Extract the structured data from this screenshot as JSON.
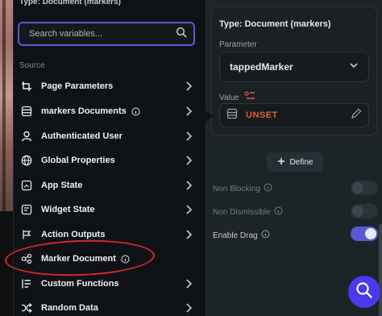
{
  "dropdown": {
    "title": "Type: Document (markers)",
    "search": {
      "placeholder": "Search variables..."
    },
    "source_label": "Source",
    "items": [
      {
        "label": "Page Parameters",
        "icon": "page-parameters-icon",
        "info": false
      },
      {
        "label": "markers Documents",
        "icon": "documents-icon",
        "info": true
      },
      {
        "label": "Authenticated User",
        "icon": "user-icon",
        "info": false
      },
      {
        "label": "Global Properties",
        "icon": "globe-icon",
        "info": false
      },
      {
        "label": "App State",
        "icon": "app-state-icon",
        "info": false
      },
      {
        "label": "Widget State",
        "icon": "widget-state-icon",
        "info": false
      },
      {
        "label": "Action Outputs",
        "icon": "action-outputs-icon",
        "info": false
      },
      {
        "label": "Marker Document",
        "icon": "marker-document-icon",
        "info": true
      },
      {
        "label": "Custom Functions",
        "icon": "custom-functions-icon",
        "info": false
      },
      {
        "label": "Random Data",
        "icon": "shuffle-icon",
        "info": false
      }
    ]
  },
  "properties": {
    "type_label": "Type: Document (markers)",
    "parameter_label": "Parameter",
    "parameter_value": "tappedMarker",
    "value_label": "Value",
    "value_text": "UNSET",
    "define_label": "Define",
    "toggles": [
      {
        "label": "Non Blocking",
        "on": false
      },
      {
        "label": "Non Dismissible",
        "on": false
      },
      {
        "label": "Enable Drag",
        "on": true
      }
    ]
  },
  "colors": {
    "accent": "#4b39ef",
    "search_border": "#5a57e0",
    "unset_text": "#e05e3a",
    "annotation_circle": "#d7262c"
  }
}
